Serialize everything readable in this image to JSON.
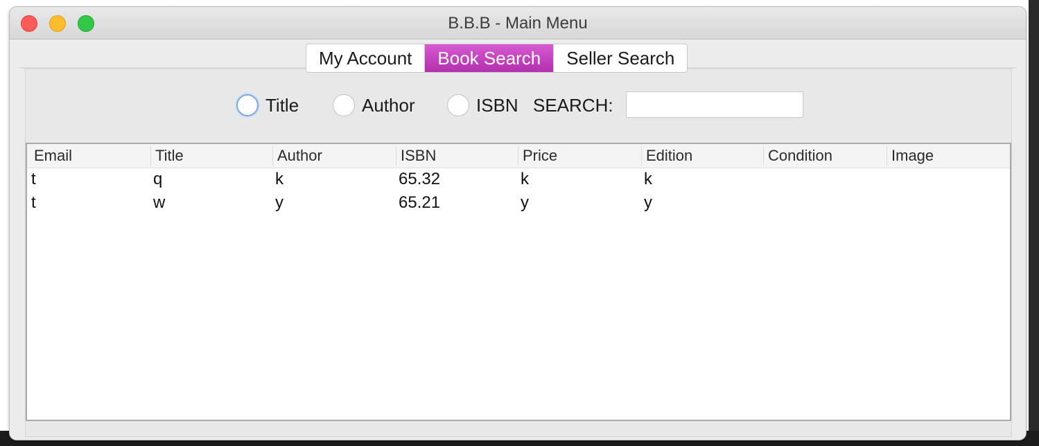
{
  "window": {
    "title": "B.B.B - Main Menu"
  },
  "tabs": [
    {
      "label": "My Account",
      "selected": false
    },
    {
      "label": "Book Search",
      "selected": true
    },
    {
      "label": "Seller Search",
      "selected": false
    }
  ],
  "search": {
    "options": [
      {
        "label": "Title",
        "checked": false,
        "focused": true
      },
      {
        "label": "Author",
        "checked": false,
        "focused": false
      },
      {
        "label": "ISBN",
        "checked": false,
        "focused": false
      }
    ],
    "label": "SEARCH:",
    "value": ""
  },
  "table": {
    "columns": [
      "Email",
      "Title",
      "Author",
      "ISBN",
      "Price",
      "Edition",
      "Condition",
      "Image"
    ],
    "rows": [
      [
        "t",
        "q",
        "k",
        "65.32",
        "k",
        "k",
        "",
        ""
      ],
      [
        "t",
        "w",
        "y",
        "65.21",
        "y",
        "y",
        "",
        ""
      ]
    ]
  },
  "colors": {
    "selected_tab": "#c23fbd",
    "close": "#fc5b57",
    "minimize": "#fdbc2e",
    "maximize": "#33c748"
  }
}
